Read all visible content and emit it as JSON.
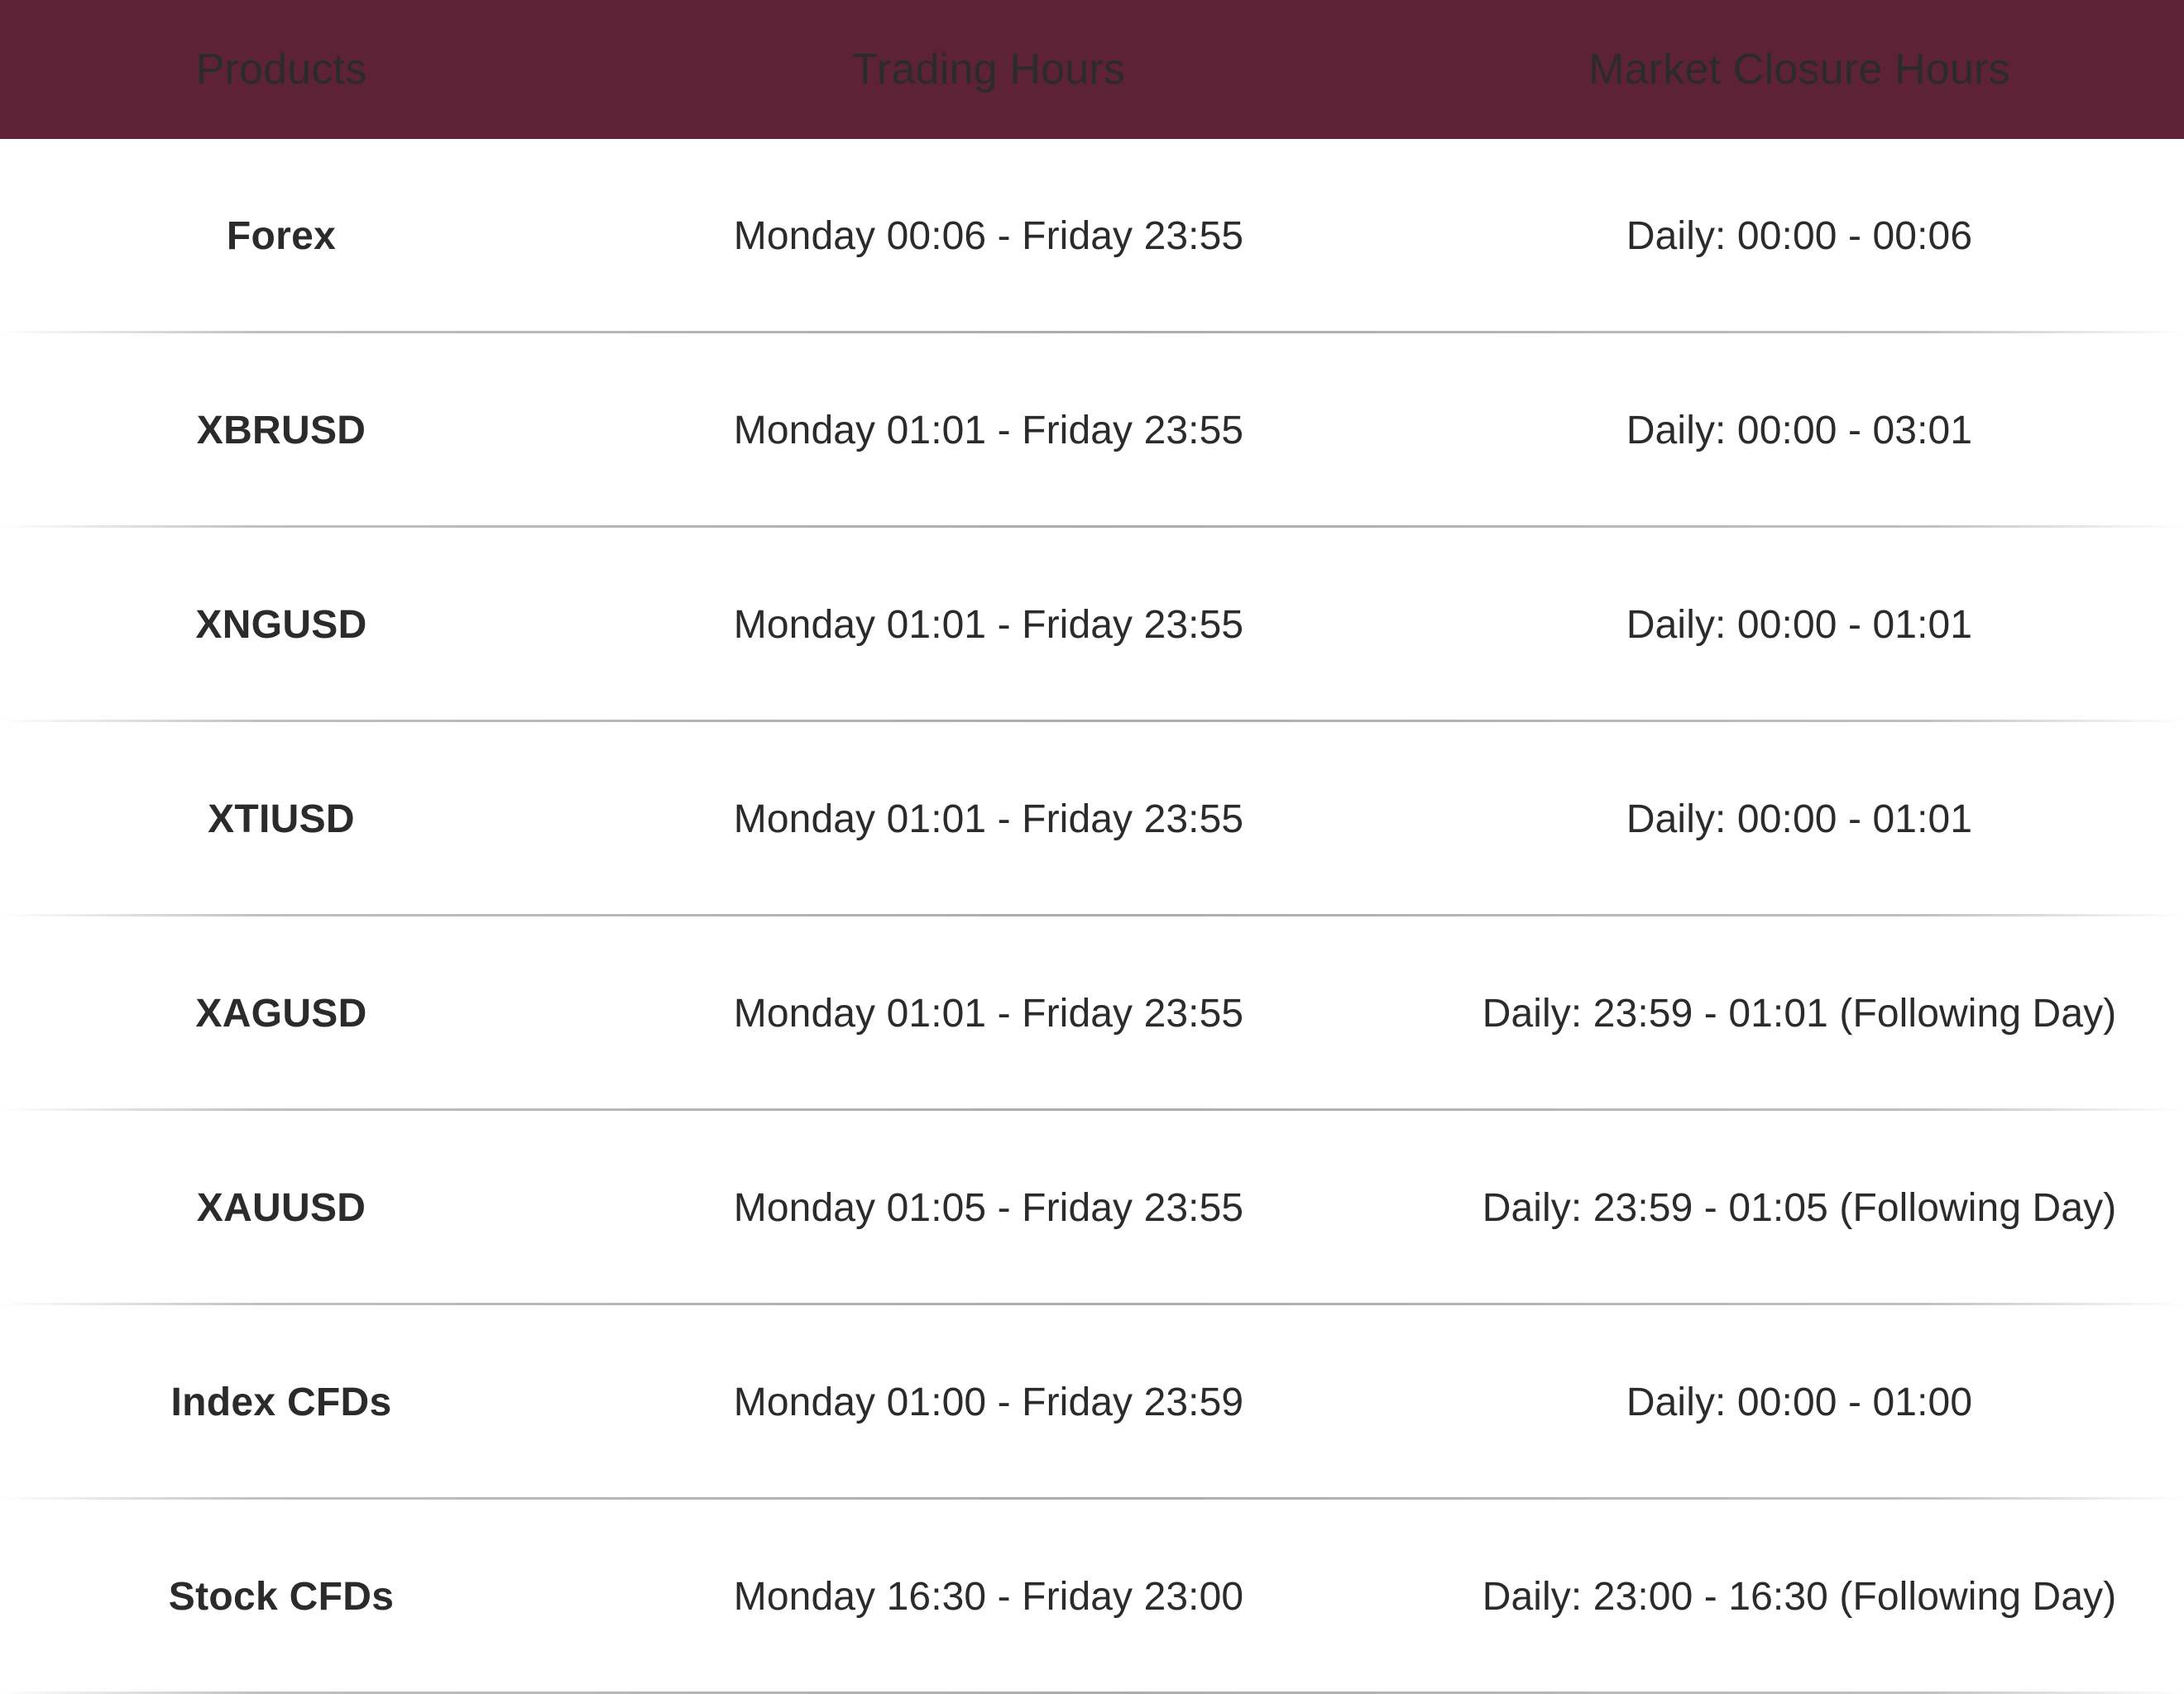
{
  "theme": {
    "header_background": "#5E2237",
    "header_text": "#FFFFFF",
    "body_background": "#FFFFFF",
    "body_text": "#2B2B2B",
    "divider": "#ACACAF"
  },
  "table": {
    "columns": [
      {
        "key": "products",
        "label": "Products"
      },
      {
        "key": "trading_hours",
        "label": "Trading Hours"
      },
      {
        "key": "market_closure_hours",
        "label": "Market Closure Hours"
      }
    ],
    "rows": [
      {
        "product": "Forex",
        "trading_hours": "Monday 00:06 - Friday 23:55",
        "market_closure_hours": "Daily: 00:00 - 00:06"
      },
      {
        "product": "XBRUSD",
        "trading_hours": "Monday 01:01 - Friday 23:55",
        "market_closure_hours": "Daily: 00:00 - 03:01"
      },
      {
        "product": "XNGUSD",
        "trading_hours": "Monday 01:01 - Friday 23:55",
        "market_closure_hours": "Daily: 00:00 - 01:01"
      },
      {
        "product": "XTIUSD",
        "trading_hours": "Monday 01:01 - Friday 23:55",
        "market_closure_hours": "Daily: 00:00 - 01:01"
      },
      {
        "product": "XAGUSD",
        "trading_hours": "Monday 01:01 - Friday 23:55",
        "market_closure_hours": "Daily: 23:59 - 01:01 (Following Day)"
      },
      {
        "product": "XAUUSD",
        "trading_hours": "Monday 01:05 - Friday 23:55",
        "market_closure_hours": "Daily: 23:59 - 01:05 (Following Day)"
      },
      {
        "product": "Index CFDs",
        "trading_hours": "Monday 01:00 - Friday 23:59",
        "market_closure_hours": "Daily: 00:00 - 01:00"
      },
      {
        "product": "Stock CFDs",
        "trading_hours": "Monday 16:30 - Friday 23:00",
        "market_closure_hours": "Daily: 23:00 - 16:30 (Following Day)"
      }
    ]
  }
}
